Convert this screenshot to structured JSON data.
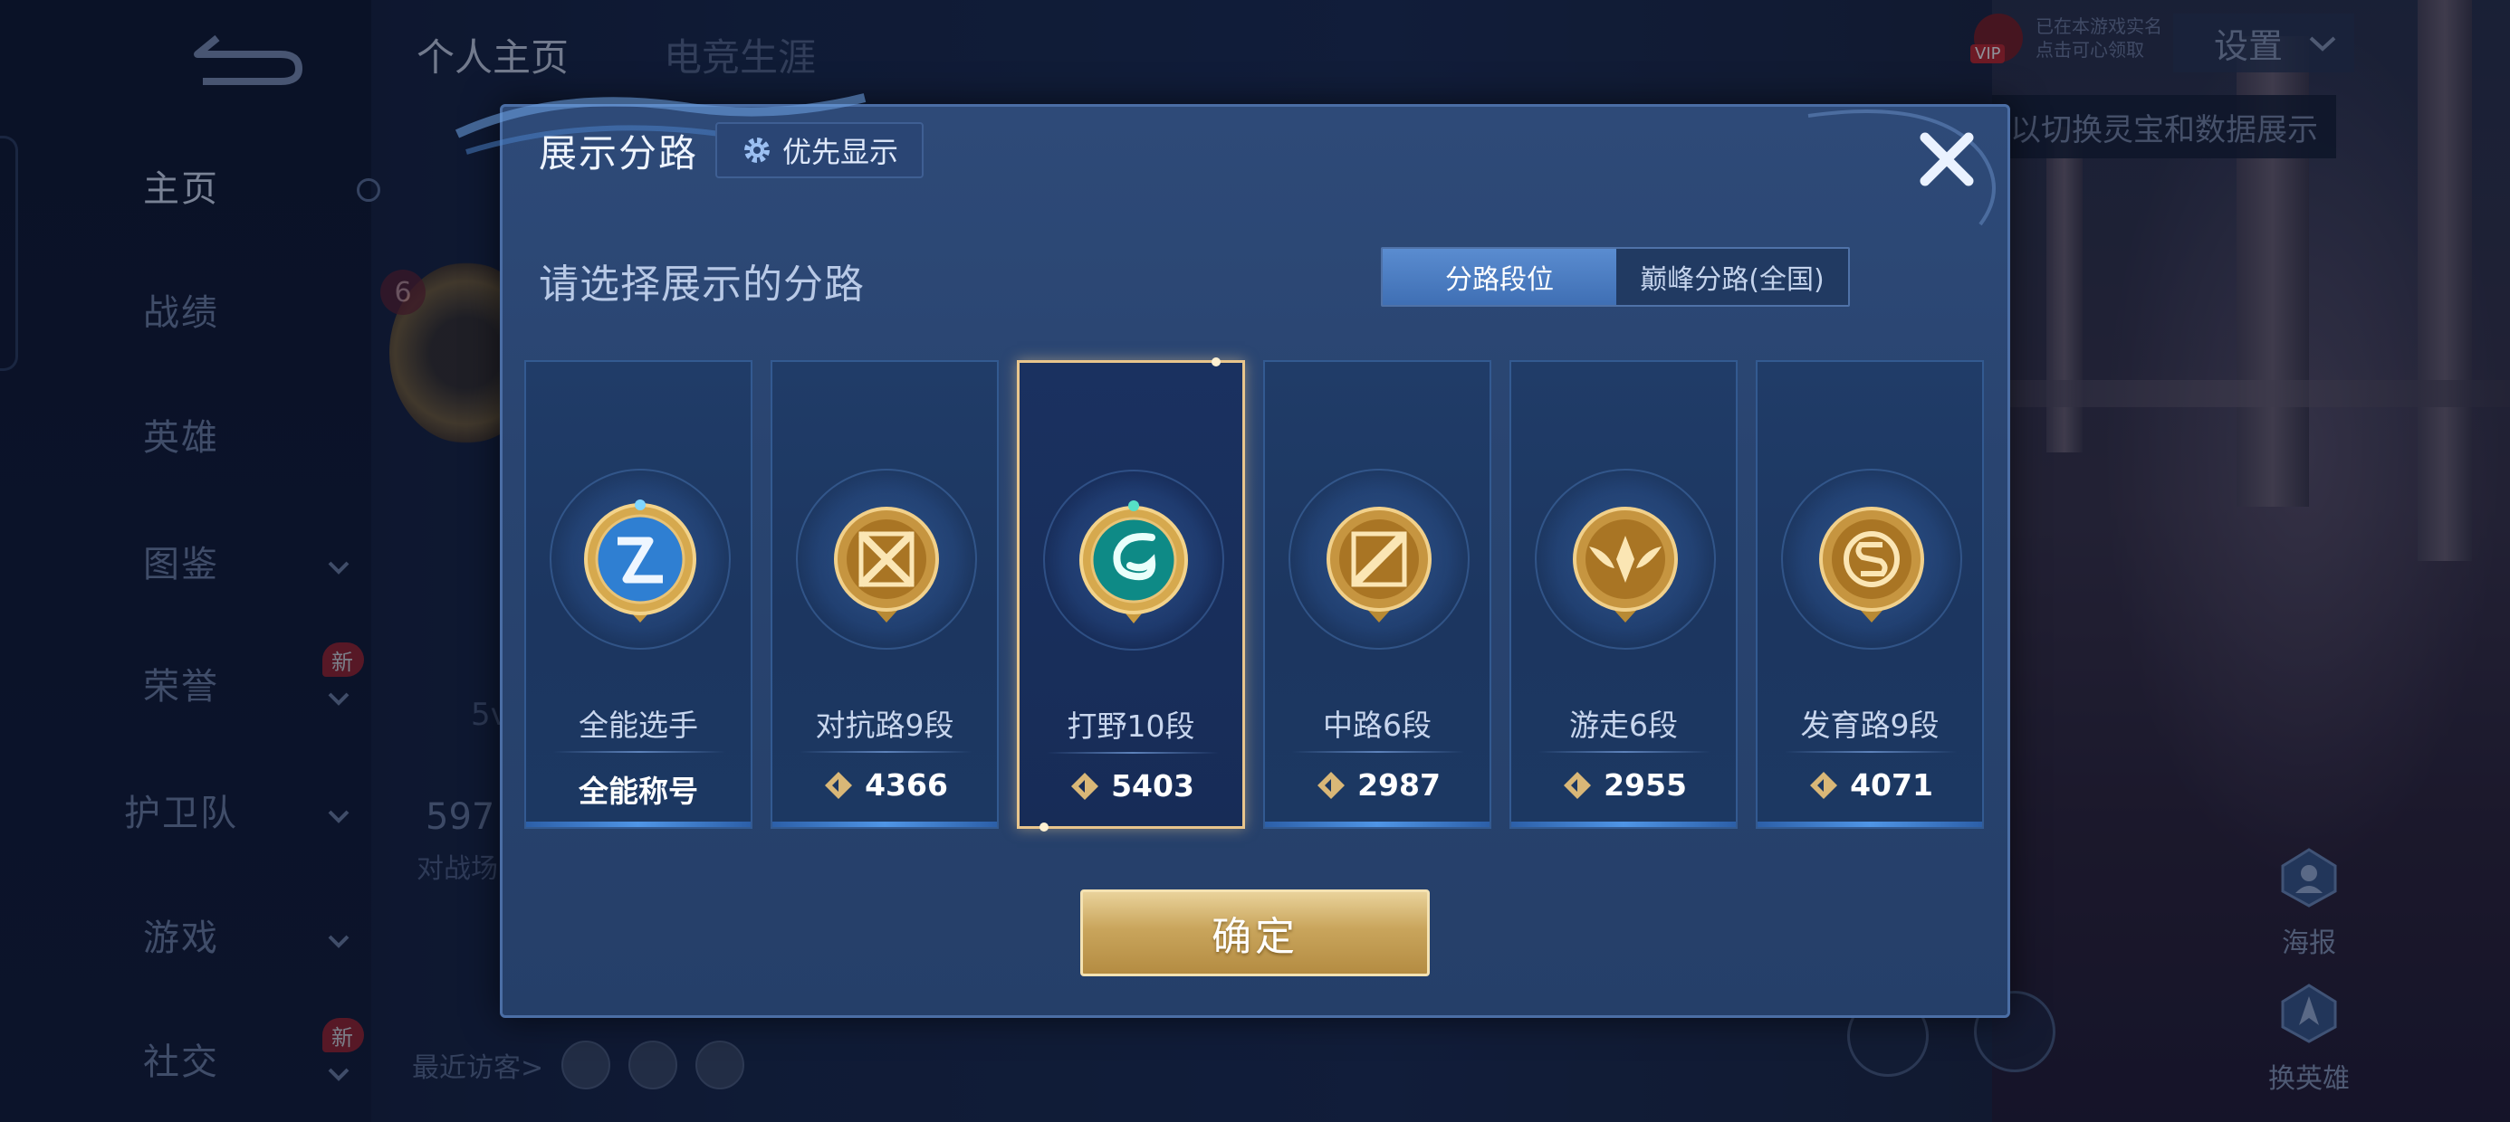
{
  "sidebar": {
    "items": [
      {
        "label": "主页",
        "active": true
      },
      {
        "label": "战绩"
      },
      {
        "label": "英雄"
      },
      {
        "label": "图鉴"
      },
      {
        "label": "荣誉"
      },
      {
        "label": "护卫队"
      },
      {
        "label": "游戏"
      },
      {
        "label": "社交"
      }
    ],
    "new_badge": "新"
  },
  "background": {
    "tabs": [
      "个人主页",
      "电竞生涯"
    ],
    "level": "6",
    "stat_value": "597",
    "stat_label": "对战场",
    "faded_text": "5v",
    "visitors_label": "最近访客>",
    "vip_tag": "VIP",
    "vip_line1": "已在本游戏实名",
    "vip_line2": "点击可心领取",
    "settings_label": "设置",
    "hint_text": "以切换灵宝和数据展示",
    "poster_label": "海报",
    "change_hero_label": "换英雄"
  },
  "modal": {
    "title": "展示分路",
    "priority_label": "优先显示",
    "subtitle": "请选择展示的分路",
    "toggle_options": [
      "分路段位",
      "巅峰分路(全国)"
    ],
    "confirm_label": "确定",
    "cards": [
      {
        "name": "全能选手",
        "score": "全能称号",
        "emblem": "all-round-emblem",
        "has_score_icon": false
      },
      {
        "name": "对抗路9段",
        "score": "4366",
        "emblem": "clash-lane-emblem",
        "has_score_icon": true
      },
      {
        "name": "打野10段",
        "score": "5403",
        "emblem": "jungle-emblem",
        "has_score_icon": true,
        "selected": true
      },
      {
        "name": "中路6段",
        "score": "2987",
        "emblem": "mid-lane-emblem",
        "has_score_icon": true
      },
      {
        "name": "游走6段",
        "score": "2955",
        "emblem": "roam-emblem",
        "has_score_icon": true
      },
      {
        "name": "发育路9段",
        "score": "4071",
        "emblem": "farm-lane-emblem",
        "has_score_icon": true
      }
    ]
  },
  "colors": {
    "accent_gold": "#e8c58c",
    "toggle_active": "#4a7dc4",
    "modal_bg": "#2b4774"
  }
}
